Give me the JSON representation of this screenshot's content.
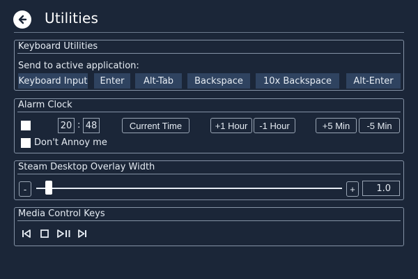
{
  "header": {
    "title": "Utilities",
    "back_icon": "back-arrow-circle-icon"
  },
  "keyboard": {
    "title": "Keyboard Utilities",
    "send_label": "Send to active application:",
    "buttons": [
      "Keyboard Input",
      "Enter",
      "Alt-Tab",
      "Backspace",
      "10x Backspace",
      "Alt-Enter"
    ]
  },
  "alarm": {
    "title": "Alarm Clock",
    "hour": "20",
    "separator": ":",
    "minute": "48",
    "current_time_label": "Current Time",
    "plus_hour_label": "+1 Hour",
    "minus_hour_label": "-1 Hour",
    "plus_min_label": "+5 Min",
    "minus_min_label": "-5 Min",
    "dont_annoy_label": "Don't Annoy me"
  },
  "overlay": {
    "title": "Steam Desktop Overlay Width",
    "minus_label": "-",
    "plus_label": "+",
    "value": "1.0",
    "slider_fraction": 0.04
  },
  "media": {
    "title": "Media Control Keys",
    "icons": [
      "previous-track-icon",
      "stop-icon",
      "play-pause-icon",
      "next-track-icon"
    ]
  },
  "colors": {
    "background": "#1b2638",
    "button_fill": "#2f4360",
    "border": "#8593a6",
    "text": "#e6ecf3"
  }
}
